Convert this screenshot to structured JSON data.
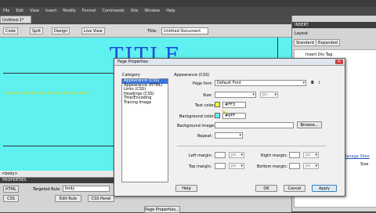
{
  "menu": [
    "File",
    "Edit",
    "View",
    "Insert",
    "Modify",
    "Format",
    "Commands",
    "Site",
    "Window",
    "Help"
  ],
  "document_tab": "Untitled-1*",
  "toolbar": {
    "code": "Code",
    "split": "Split",
    "design": "Design",
    "live_view": "Live View",
    "title_label": "Title:",
    "title_value": "Untitled Document"
  },
  "canvas": {
    "heading": "TITLE",
    "dashes": "================"
  },
  "status_tag": "<body>",
  "properties": {
    "header": "PROPERTIES",
    "html": "HTML",
    "css": "CSS",
    "targeted_rule_label": "Targeted Rule",
    "targeted_rule_value": "body",
    "edit_rule": "Edit Rule",
    "css_panel": "CSS Panel",
    "page_properties_button": "Page Properties..."
  },
  "right_panel": {
    "insert": "INSERT",
    "layout": "Layout",
    "standard": "Standard",
    "expanded": "Expanded",
    "insert_div_tag": "Insert Div Tag",
    "manage_sites": "Manage Sites",
    "size": "Size"
  },
  "dialog": {
    "title": "Page Properties",
    "category_label": "Category",
    "categories": [
      "Appearance (CSS)",
      "Appearance (HTML)",
      "Links (CSS)",
      "Headings (CSS)",
      "Title/Encoding",
      "Tracing Image"
    ],
    "section_heading": "Appearance (CSS)",
    "page_font_label": "Page font:",
    "page_font_value": "Default Font",
    "bold": "B",
    "italic": "I",
    "size_label": "Size:",
    "size_unit": "px",
    "text_color_label": "Text color:",
    "text_color_value": "#FF3",
    "text_color_hex": "#ffff33",
    "background_color_label": "Background color:",
    "background_color_value": "#6FF",
    "background_color_hex": "#66ffff",
    "background_image_label": "Background image:",
    "browse": "Browse...",
    "repeat_label": "Repeat:",
    "left_margin_label": "Left margin:",
    "right_margin_label": "Right margin:",
    "top_margin_label": "Top margin:",
    "bottom_margin_label": "Bottom margin:",
    "margin_unit": "px",
    "help": "Help",
    "ok": "OK",
    "cancel": "Cancel",
    "apply": "Apply"
  }
}
